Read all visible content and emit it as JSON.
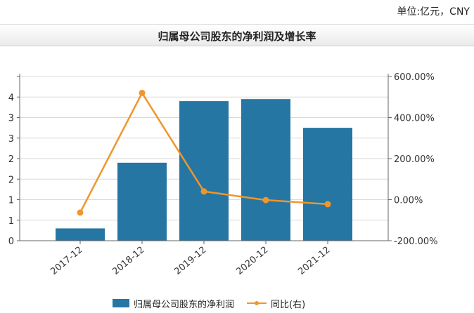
{
  "header": {
    "unit": "单位:亿元，CNY",
    "title": "归属母公司股东的净利润及增长率"
  },
  "legend": {
    "bar_label": "归属母公司股东的净利润",
    "line_label": "同比(右)"
  },
  "colors": {
    "bar": "#2676a3",
    "line": "#f0962b",
    "grid": "#d9d9d9",
    "axis": "#666666"
  },
  "chart_data": {
    "type": "bar",
    "categories": [
      "2017-12",
      "2018-12",
      "2019-12",
      "2020-12",
      "2021-12"
    ],
    "series": [
      {
        "name": "归属母公司股东的净利润",
        "type": "bar",
        "axis": "left",
        "values": [
          0.3,
          1.9,
          3.4,
          3.45,
          2.75
        ]
      },
      {
        "name": "同比(右)",
        "type": "line",
        "axis": "right",
        "values": [
          -63,
          520,
          40,
          -2,
          -22
        ]
      }
    ],
    "y_left": {
      "range": [
        0,
        4
      ],
      "ticks": [
        0,
        0.5,
        1,
        1.5,
        2,
        2.5,
        3,
        3.5,
        4
      ],
      "tick_labels": [
        "0",
        "1",
        "1",
        "2",
        "2",
        "3",
        "3",
        "4",
        ""
      ]
    },
    "y_right": {
      "range": [
        -200,
        600
      ],
      "ticks": [
        -200,
        0,
        200,
        400,
        600
      ],
      "tick_labels": [
        "-200.00%",
        "0.00%",
        "200.00%",
        "400.00%",
        "600.00%"
      ]
    },
    "grid": true,
    "legend_position": "bottom"
  }
}
